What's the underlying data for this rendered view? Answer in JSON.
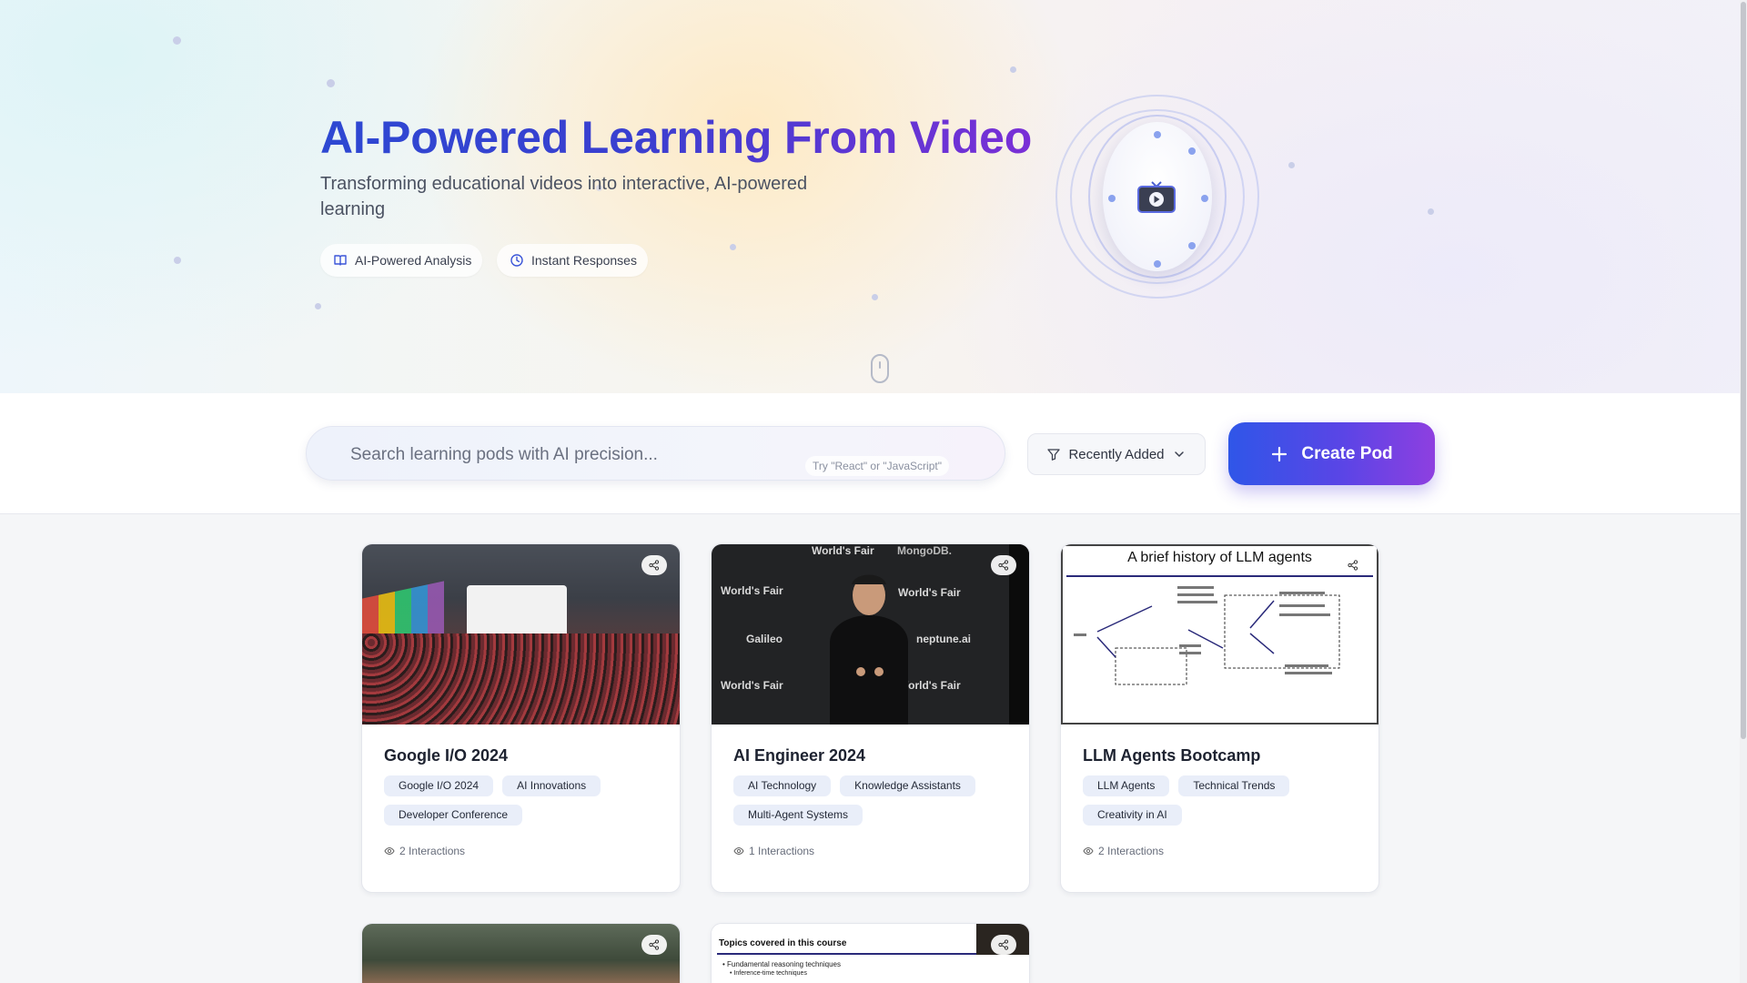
{
  "hero": {
    "title": "AI-Powered Learning From Video",
    "subtitle": "Transforming educational videos into interactive, AI-powered learning",
    "features": [
      {
        "label": "AI-Powered Analysis",
        "icon": "book-icon"
      },
      {
        "label": "Instant Responses",
        "icon": "clock-icon"
      }
    ],
    "illustration_icon": "video-player-icon",
    "scroll_icon": "mouse-scroll-icon"
  },
  "toolbar": {
    "search": {
      "placeholder": "Search learning pods with AI precision...",
      "value": "",
      "hint": "Try \"React\" or \"JavaScript\""
    },
    "sort": {
      "label": "Recently Added",
      "icon": "filter-icon"
    },
    "create": {
      "label": "Create Pod",
      "icon": "plus-icon"
    }
  },
  "pods": [
    {
      "title": "Google I/O 2024",
      "tags": [
        "Google I/O 2024",
        "AI Innovations",
        "Developer Conference"
      ],
      "interactions": "2 Interactions"
    },
    {
      "title": "AI Engineer 2024",
      "tags": [
        "AI Technology",
        "Knowledge Assistants",
        "Multi-Agent Systems"
      ],
      "interactions": "1 Interactions",
      "thumb_text": [
        "World's Fair",
        "MongoDB.",
        "World's Fair",
        "World's Fair",
        "Galileo",
        "neptune.ai",
        "World's Fair",
        "World's Fair"
      ]
    },
    {
      "title": "LLM Agents Bootcamp",
      "tags": [
        "LLM Agents",
        "Technical Trends",
        "Creativity in AI"
      ],
      "interactions": "2 Interactions",
      "slide_title": "A brief history of LLM agents"
    }
  ],
  "partial_cards": [
    {
      "slide_title": "Topics covered in this course",
      "bullets": [
        "Fundamental reasoning techniques",
        "Inference-time techniques"
      ]
    }
  ],
  "colors": {
    "accent_blue": "#2f56e8",
    "accent_purple": "#8e3fe0",
    "tag_bg": "#e9eef9"
  }
}
